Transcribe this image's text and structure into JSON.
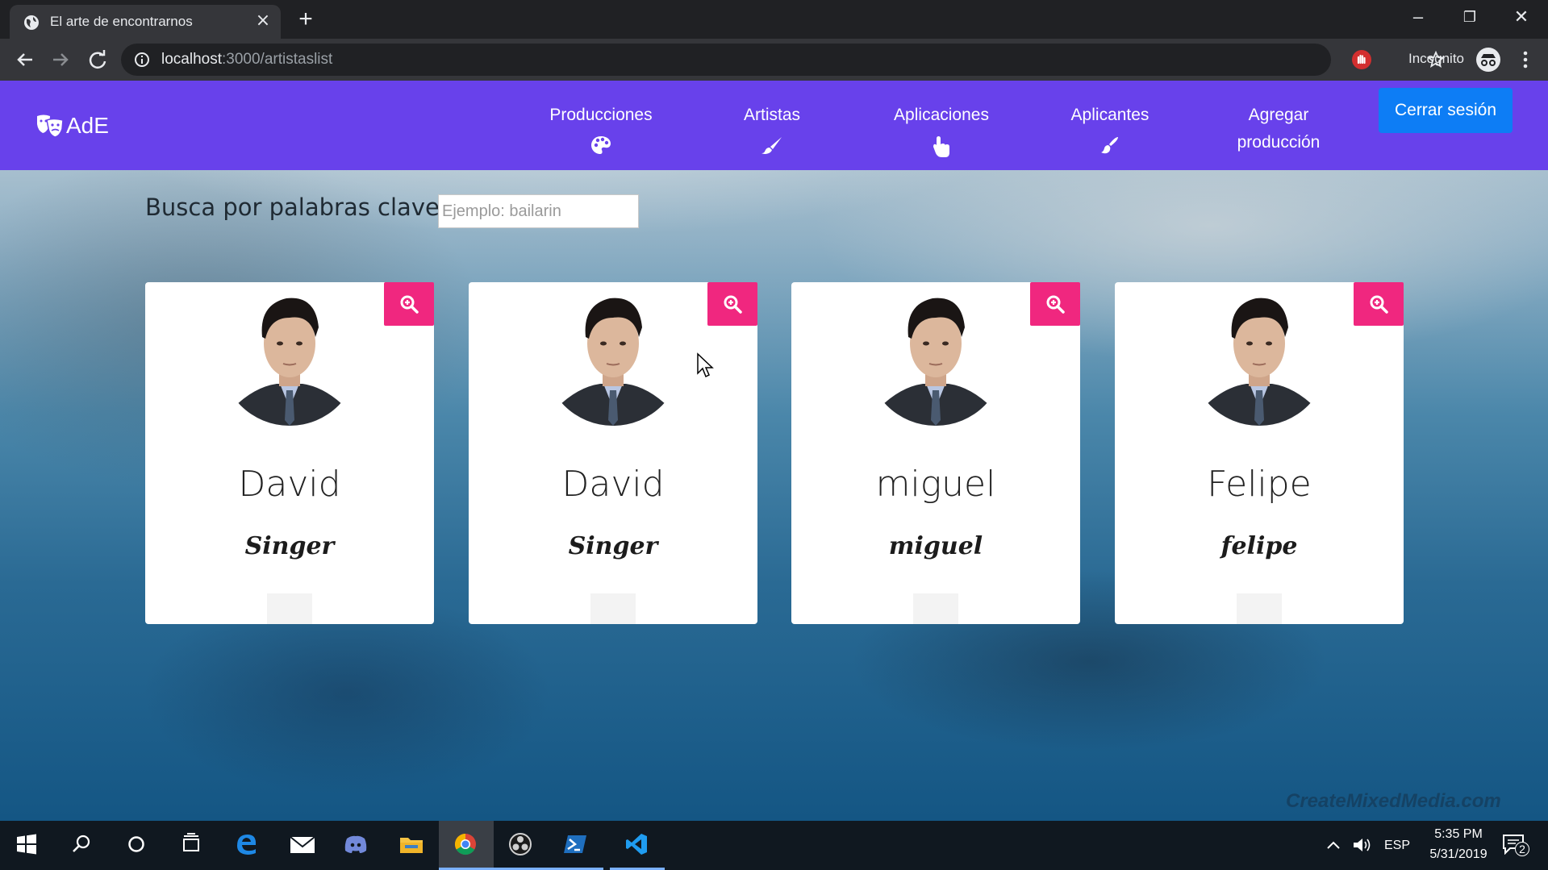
{
  "browser": {
    "tab_title": "El arte de encontrarnos",
    "tab_close": "×",
    "new_tab": "+",
    "url_host": "localhost",
    "url_path": ":3000/artistaslist",
    "incognito_label": "Incognito",
    "window_controls": {
      "minimize": "–",
      "restore": "❐",
      "close": "✕"
    }
  },
  "navbar": {
    "brand": "AdE",
    "items": [
      {
        "label": "Producciones",
        "icon": "palette-icon"
      },
      {
        "label": "Artistas",
        "icon": "brush-icon"
      },
      {
        "label": "Aplicaciones",
        "icon": "hand-pointer-icon"
      },
      {
        "label": "Aplicantes",
        "icon": "paint-brush-icon"
      },
      {
        "label_line1": "Agregar",
        "label_line2": "producción"
      }
    ],
    "logout_label": "Cerrar sesión",
    "colors": {
      "navbar": "#6841eb",
      "logout": "#0d7df5"
    }
  },
  "search": {
    "label": "Busca por palabras clave:",
    "placeholder": "Ejemplo: bailarin",
    "value": ""
  },
  "cards": [
    {
      "name": "David",
      "role": "Singer"
    },
    {
      "name": "David",
      "role": "Singer"
    },
    {
      "name": "miguel",
      "role": "miguel"
    },
    {
      "name": "Felipe",
      "role": "felipe"
    }
  ],
  "card_accent": "#f0277f",
  "watermark": "CreateMixedMedia.com",
  "taskbar": {
    "language": "ESP",
    "time": "5:35 PM",
    "date": "5/31/2019",
    "notification_count": "2"
  }
}
